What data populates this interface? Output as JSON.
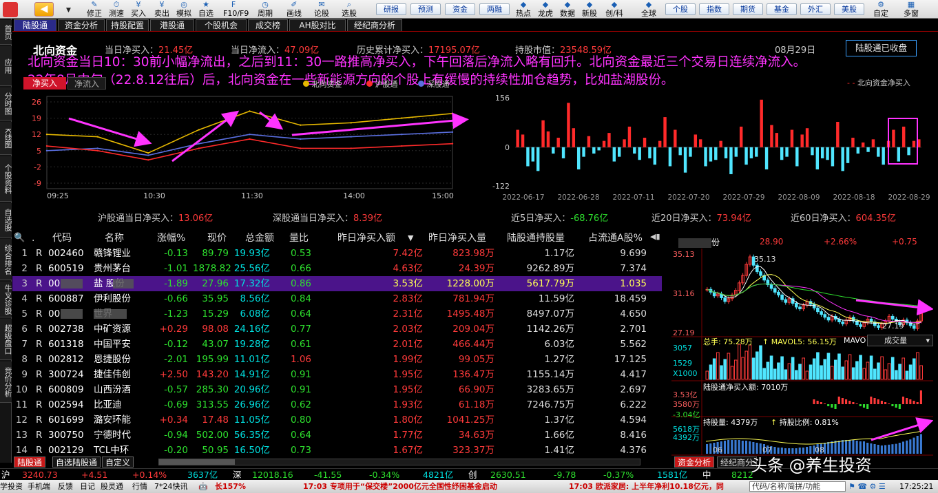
{
  "toolbar": {
    "buttons": [
      "修正",
      "测速",
      "买入",
      "卖出",
      "模拟",
      "自选",
      "F10/F9",
      "周期",
      "画线",
      "论股",
      "选股"
    ],
    "buttons2": [
      "研报",
      "预测",
      "资金",
      "两融",
      "热点",
      "龙虎",
      "数据",
      "新股",
      "创/科",
      "全球"
    ],
    "buttons3": [
      "个股",
      "指数",
      "期货",
      "基金",
      "外汇",
      "美股"
    ],
    "right": [
      "自定",
      "多窗"
    ]
  },
  "left_sidebar": [
    "首页",
    "应用",
    "分时图",
    "K线图",
    "个股资料",
    "自选股",
    "综合排名",
    "牛叉诊股",
    "超级盘口",
    "竞价分析"
  ],
  "tabs": [
    "陆股通",
    "资金分析",
    "持股配置",
    "港股通",
    "个股机会",
    "成交榜",
    "AH股对比",
    "经纪商分析"
  ],
  "summary": {
    "title": "北向资金",
    "today_net_buy_label": "当日净买入：",
    "today_net_buy": "21.45亿",
    "today_inflow_label": "当日净流入：",
    "today_inflow": "47.09亿",
    "hist_label": "历史累计净买入：",
    "hist": "17195.07亿",
    "holding_label": "持股市值：",
    "holding": "23548.59亿",
    "date": "08月29日",
    "closed_btn": "陆股通已收盘"
  },
  "overlay_text": [
    "北向资金当日10：30前小幅净流出，之后到11：30一路推高净买入，下午回落后净流入略有回升。北向资金最近三个交易日连续净流入。",
    "22年8月中旬（22.8.12往后）后，北向资金在一些新能源方向的个股上有缓慢的持续性加仓趋势，比如盐湖股份。"
  ],
  "intraday_chart": {
    "tabs": [
      "净买入",
      "净流入"
    ],
    "legend": [
      "北向资金",
      "沪股通",
      "深股通"
    ],
    "yticks": [
      "26",
      "19",
      "12",
      "5",
      "-2",
      "-9"
    ],
    "xticks": [
      "09:25",
      "10:30",
      "11:30",
      "14:00",
      "15:00"
    ],
    "sh_label": "沪股通当日净买入：",
    "sh_value": "13.06亿",
    "sz_label": "深股通当日净买入：",
    "sz_value": "8.39亿"
  },
  "chart_data": [
    {
      "type": "line",
      "x": [
        "09:25",
        "10:00",
        "10:30",
        "11:00",
        "11:30",
        "13:30",
        "14:00",
        "14:30",
        "15:00"
      ],
      "ylim": [
        -9,
        26
      ],
      "series": [
        {
          "name": "北向资金",
          "values": [
            12,
            11,
            4,
            14,
            22,
            16,
            17,
            19,
            21
          ]
        },
        {
          "name": "沪股通",
          "values": [
            5,
            6,
            3,
            8,
            12,
            10,
            11,
            12,
            13
          ]
        },
        {
          "name": "深股通",
          "values": [
            7,
            5,
            1,
            6,
            10,
            6,
            6,
            7,
            8
          ]
        }
      ],
      "colors": [
        "#e6b800",
        "#5a6fe0",
        "#ff2a2a"
      ]
    },
    {
      "type": "bar",
      "legend": "北向资金净买入",
      "ylim": [
        -122,
        156
      ],
      "yticks": [
        "156",
        "0",
        "-122"
      ],
      "xticks": [
        "2022-06-17",
        "2022-06-28",
        "2022-07-11",
        "2022-07-20",
        "2022-07-29",
        "2022-08-09",
        "2022-08-18",
        "2022-08-29"
      ],
      "values": [
        55,
        40,
        -60,
        -45,
        -75,
        85,
        50,
        -20,
        30,
        -35,
        140,
        60,
        -70,
        -30,
        35,
        -20,
        -10,
        20,
        45,
        -45,
        -30,
        25,
        65,
        -20,
        -40,
        30,
        -35,
        -55,
        20,
        95,
        -60,
        55,
        -25,
        -80,
        -30,
        40,
        25,
        -60,
        -45,
        -40,
        20,
        -35,
        -85,
        -30,
        65,
        -55,
        -35,
        -30,
        150,
        -70,
        70,
        45,
        -40,
        -30,
        55,
        -60,
        40,
        60,
        -25,
        -70,
        -35,
        -40,
        -60,
        80,
        -75,
        -50,
        30,
        -20,
        15,
        -15,
        25,
        -30,
        -55,
        20,
        55,
        -45,
        65,
        -25,
        20,
        25
      ]
    }
  ],
  "north_bar": {
    "legend": "北向资金净买入",
    "n5_label": "近5日净买入：",
    "n5": "-68.76亿",
    "n20_label": "近20日净买入：",
    "n20": "73.94亿",
    "n60_label": "近60日净买入：",
    "n60": "604.35亿"
  },
  "table": {
    "headers": [
      ".",
      "代码",
      "名称",
      "涨幅%",
      "现价",
      "总金额",
      "量比",
      "昨日净买入额",
      "昨日净买入量",
      "陆股通持股量",
      "占流通A股%"
    ],
    "rows": [
      [
        "1",
        "R",
        "002460",
        "赣锋锂业",
        "-0.13",
        "89.79",
        "19.93亿",
        "0.53",
        "7.42亿",
        "823.98万",
        "1.17亿",
        "9.699"
      ],
      [
        "2",
        "R",
        "600519",
        "贵州茅台",
        "-1.01",
        "1878.82",
        "25.56亿",
        "0.66",
        "4.63亿",
        "24.39万",
        "9262.89万",
        "7.374"
      ],
      [
        "3",
        "R",
        "00",
        "盐  股份",
        "-1.89",
        "27.96",
        "17.32亿",
        "0.86",
        "3.53亿",
        "1228.00万",
        "5617.79万",
        "1.035"
      ],
      [
        "4",
        "R",
        "600887",
        "伊利股份",
        "-0.66",
        "35.95",
        "8.56亿",
        "0.84",
        "2.83亿",
        "781.94万",
        "11.59亿",
        "18.459"
      ],
      [
        "5",
        "R",
        "00",
        "  世界",
        "-1.23",
        "15.29",
        "6.08亿",
        "0.64",
        "2.31亿",
        "1495.48万",
        "8497.07万",
        "4.650"
      ],
      [
        "6",
        "R",
        "002738",
        "中矿资源",
        "+0.29",
        "98.08",
        "24.16亿",
        "0.77",
        "2.03亿",
        "209.04万",
        "1142.26万",
        "2.701"
      ],
      [
        "7",
        "R",
        "601318",
        "中国平安",
        "-0.12",
        "43.07",
        "19.28亿",
        "0.61",
        "2.01亿",
        "466.44万",
        "6.03亿",
        "5.562"
      ],
      [
        "8",
        "R",
        "002812",
        "恩捷股份",
        "-2.01",
        "195.99",
        "11.01亿",
        "1.06",
        "1.99亿",
        "99.05万",
        "1.27亿",
        "17.125"
      ],
      [
        "9",
        "R",
        "300724",
        "捷佳伟创",
        "+2.50",
        "143.20",
        "14.91亿",
        "0.91",
        "1.95亿",
        "136.47万",
        "1155.14万",
        "4.417"
      ],
      [
        "10",
        "R",
        "600809",
        "山西汾酒",
        "-0.57",
        "285.30",
        "20.96亿",
        "0.91",
        "1.95亿",
        "66.90万",
        "3283.65万",
        "2.697"
      ],
      [
        "11",
        "R",
        "002594",
        "比亚迪",
        "-0.69",
        "313.55",
        "26.96亿",
        "0.62",
        "1.93亿",
        "61.18万",
        "7246.75万",
        "6.222"
      ],
      [
        "12",
        "R",
        "601699",
        "潞安环能",
        "+0.34",
        "17.48",
        "11.05亿",
        "0.80",
        "1.80亿",
        "1041.25万",
        "1.37亿",
        "4.594"
      ],
      [
        "13",
        "R",
        "300750",
        "宁德时代",
        "-0.94",
        "502.00",
        "56.35亿",
        "0.64",
        "1.77亿",
        "34.63万",
        "1.66亿",
        "8.416"
      ],
      [
        "14",
        "R",
        "002129",
        "TCL中环",
        "-0.20",
        "50.95",
        "16.50亿",
        "0.73",
        "1.67亿",
        "323.37万",
        "1.41亿",
        "4.376"
      ]
    ]
  },
  "right_panel": {
    "name": "份",
    "price": "28.90",
    "pct": "+2.66%",
    "chg": "+0.75",
    "p_high": "35.13",
    "p_mid": "31.16",
    "p_low": "27.19",
    "peak_label": "35.13",
    "low_label": "27.19",
    "vol_label": "总手: 75.28万",
    "mavol_label": "MAVOL5: 56.15万",
    "mavo": "MAVO",
    "vol_select": "成交量",
    "vol_ticks": [
      "3057",
      "1529",
      "X1000"
    ],
    "nb_label": "陆股通净买入额: 7010万",
    "nb_ticks": [
      "3.53亿",
      "3580万",
      "-3.04亿"
    ],
    "hold_label": "持股量: 4379万",
    "ratio_label": "持股比例: 0.81%",
    "hold_ticks": [
      "5618万",
      "4392万"
    ],
    "xticks": [
      "06",
      "07",
      "08"
    ],
    "tabs": [
      "资金分析",
      "经纪商分"
    ]
  },
  "bottom_tabs": [
    "陆股通",
    "自选陆股通",
    "自定义"
  ],
  "index_bar": {
    "sh": [
      "沪",
      "3240.73",
      "+4.51",
      "+0.14%",
      "3637亿"
    ],
    "sz": [
      "深",
      "12018.16",
      "-41.55",
      "-0.34%",
      "4821亿"
    ],
    "cy": [
      "创",
      "2630.51",
      "-9.78",
      "-0.37%",
      "1581亿"
    ],
    "zz": [
      "中",
      "8212"
    ]
  },
  "status_bar": {
    "items": [
      "学投资",
      "手机端",
      "反馈",
      "日记",
      "股灵通",
      "行情",
      "7*24快讯"
    ],
    "ticker1_pct": "长157%",
    "ticker2": "17:03 专项用于“保交楼”2000亿元全国性纾困基金启动",
    "ticker3": "17:03 欧派家居: 上半年净利10.18亿元，同",
    "search": "代码/名称/简拼/功能",
    "time": "17:25:21"
  },
  "watermark": "头条 @养生投资"
}
